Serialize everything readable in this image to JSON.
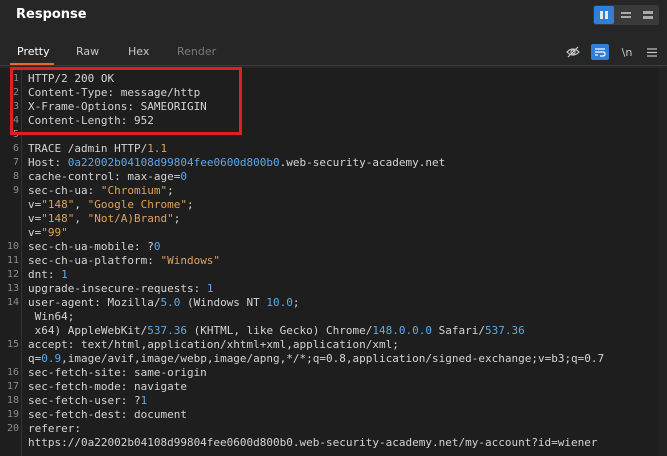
{
  "header": {
    "title": "Response"
  },
  "tabs": [
    {
      "label": "Pretty",
      "state": "active"
    },
    {
      "label": "Raw",
      "state": "normal"
    },
    {
      "label": "Hex",
      "state": "normal"
    },
    {
      "label": "Render",
      "state": "disabled"
    }
  ],
  "toolbar": {
    "newline_label": "\\n",
    "icons": [
      "eye-slash-icon",
      "wrap-icon",
      "newline-toggle",
      "menu-icon"
    ]
  },
  "lines": [
    {
      "n": "1",
      "parts": [
        [
          "HTTP/2 200 OK",
          ""
        ]
      ]
    },
    {
      "n": "2",
      "parts": [
        [
          "Content-Type: message/http",
          ""
        ]
      ]
    },
    {
      "n": "3",
      "parts": [
        [
          "X-Frame-Options: SAMEORIGIN",
          ""
        ]
      ]
    },
    {
      "n": "4",
      "parts": [
        [
          "Content-Length: 952",
          ""
        ]
      ]
    },
    {
      "n": "5",
      "parts": [
        [
          "",
          ""
        ]
      ]
    },
    {
      "n": "6",
      "parts": [
        [
          "TRACE /admin HTTP/",
          ""
        ],
        [
          "1.1",
          "v"
        ]
      ]
    },
    {
      "n": "7",
      "parts": [
        [
          "Host: ",
          ""
        ],
        [
          "0a22002b04108d99804fee0600d800b0",
          "b"
        ],
        [
          ".web-security-academy.net",
          ""
        ]
      ]
    },
    {
      "n": "8",
      "parts": [
        [
          "cache-control: max-age=",
          ""
        ],
        [
          "0",
          "b"
        ]
      ]
    },
    {
      "n": "9",
      "parts": [
        [
          "sec-ch-ua: ",
          ""
        ],
        [
          "\"Chromium\"",
          "v"
        ],
        [
          ";",
          ""
        ]
      ]
    },
    {
      "n": "",
      "parts": [
        [
          "v=",
          ""
        ],
        [
          "\"148\"",
          "v"
        ],
        [
          ", ",
          ""
        ],
        [
          "\"Google Chrome\"",
          "v"
        ],
        [
          ";",
          ""
        ]
      ]
    },
    {
      "n": "",
      "parts": [
        [
          "v=",
          ""
        ],
        [
          "\"148\"",
          "v"
        ],
        [
          ", ",
          ""
        ],
        [
          "\"Not/A)Brand\"",
          "v"
        ],
        [
          ";",
          ""
        ]
      ]
    },
    {
      "n": "",
      "parts": [
        [
          "v=",
          ""
        ],
        [
          "\"99\"",
          "v"
        ]
      ]
    },
    {
      "n": "10",
      "parts": [
        [
          "sec-ch-ua-mobile: ?",
          ""
        ],
        [
          "0",
          "b"
        ]
      ]
    },
    {
      "n": "11",
      "parts": [
        [
          "sec-ch-ua-platform: ",
          ""
        ],
        [
          "\"Windows\"",
          "v"
        ]
      ]
    },
    {
      "n": "12",
      "parts": [
        [
          "dnt: ",
          ""
        ],
        [
          "1",
          "b"
        ]
      ]
    },
    {
      "n": "13",
      "parts": [
        [
          "upgrade-insecure-requests: ",
          ""
        ],
        [
          "1",
          "b"
        ]
      ]
    },
    {
      "n": "14",
      "parts": [
        [
          "user-agent: Mozilla/",
          ""
        ],
        [
          "5.0",
          "b"
        ],
        [
          " (Windows NT ",
          ""
        ],
        [
          "10.0",
          "b"
        ],
        [
          ";",
          ""
        ]
      ]
    },
    {
      "n": "",
      "parts": [
        [
          " Win64;",
          ""
        ]
      ]
    },
    {
      "n": "",
      "parts": [
        [
          " x64) AppleWebKit/",
          ""
        ],
        [
          "537.36",
          "b"
        ],
        [
          " (KHTML, like Gecko) Chrome/",
          ""
        ],
        [
          "148.0.0.0",
          "b"
        ],
        [
          " Safari/",
          ""
        ],
        [
          "537.36",
          "b"
        ]
      ]
    },
    {
      "n": "15",
      "parts": [
        [
          "accept: text/html,application/xhtml+xml,application/xml;",
          ""
        ]
      ]
    },
    {
      "n": "",
      "parts": [
        [
          "q=",
          ""
        ],
        [
          "0.9",
          "b"
        ],
        [
          ",image/avif,image/webp,image/apng,*/*;q=0.8,application/signed-exchange;v=b3;q=0.7",
          ""
        ]
      ]
    },
    {
      "n": "16",
      "parts": [
        [
          "sec-fetch-site: same-origin",
          ""
        ]
      ]
    },
    {
      "n": "17",
      "parts": [
        [
          "sec-fetch-mode: navigate",
          ""
        ]
      ]
    },
    {
      "n": "18",
      "parts": [
        [
          "sec-fetch-user: ?",
          ""
        ],
        [
          "1",
          "b"
        ]
      ]
    },
    {
      "n": "19",
      "parts": [
        [
          "sec-fetch-dest: document",
          ""
        ]
      ]
    },
    {
      "n": "20",
      "parts": [
        [
          "referer:",
          ""
        ]
      ]
    },
    {
      "n": "",
      "parts": [
        [
          "https://0a22002b04108d99804fee0600d800b0.web-security-academy.net/my-account?id=wiener",
          ""
        ]
      ]
    }
  ]
}
